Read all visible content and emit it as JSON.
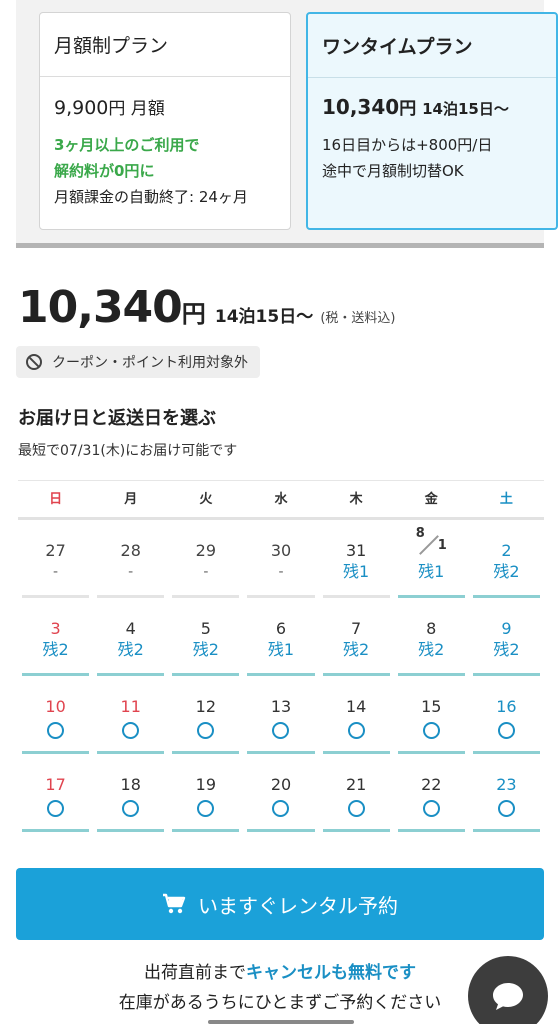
{
  "plans": {
    "monthly": {
      "title": "月額制プラン",
      "price_num": "9,900",
      "price_unit": "円 月額",
      "promo_line1": "3ヶ月以上のご利用で",
      "promo_line2": "解約料が0円に",
      "note": "月額課金の自動終了: 24ヶ月"
    },
    "onetime": {
      "title": "ワンタイムプラン",
      "price_num": "10,340",
      "price_unit": "円",
      "price_period": "14泊15日〜",
      "line1": "16日目からは+800円/日",
      "line2": "途中で月額制切替OK"
    }
  },
  "main_price": {
    "amount": "10,340",
    "yen": "円",
    "period": "14泊15日〜",
    "tax": "(税・送料込)"
  },
  "coupon_notice": "クーポン・ポイント利用対象外",
  "section": {
    "title": "お届け日と返送日を選ぶ",
    "subtitle": "最短で07/31(木)にお届け可能です"
  },
  "calendar": {
    "weekdays": [
      "日",
      "月",
      "火",
      "水",
      "木",
      "金",
      "土"
    ],
    "rows": [
      [
        {
          "date": "27",
          "status": "-"
        },
        {
          "date": "28",
          "status": "-"
        },
        {
          "date": "29",
          "status": "-"
        },
        {
          "date": "30",
          "status": "-"
        },
        {
          "date": "31",
          "status": "残1"
        },
        {
          "date_a": "8",
          "date_b": "1",
          "status": "残1"
        },
        {
          "date": "2",
          "status": "残2"
        }
      ],
      [
        {
          "date": "3",
          "status": "残2"
        },
        {
          "date": "4",
          "status": "残2"
        },
        {
          "date": "5",
          "status": "残2"
        },
        {
          "date": "6",
          "status": "残1"
        },
        {
          "date": "7",
          "status": "残2"
        },
        {
          "date": "8",
          "status": "残2"
        },
        {
          "date": "9",
          "status": "残2"
        }
      ],
      [
        {
          "date": "10",
          "status": "circle"
        },
        {
          "date": "11",
          "status": "circle"
        },
        {
          "date": "12",
          "status": "circle"
        },
        {
          "date": "13",
          "status": "circle"
        },
        {
          "date": "14",
          "status": "circle"
        },
        {
          "date": "15",
          "status": "circle"
        },
        {
          "date": "16",
          "status": "circle"
        }
      ],
      [
        {
          "date": "17",
          "status": "circle"
        },
        {
          "date": "18",
          "status": "circle"
        },
        {
          "date": "19",
          "status": "circle"
        },
        {
          "date": "20",
          "status": "circle"
        },
        {
          "date": "21",
          "status": "circle"
        },
        {
          "date": "22",
          "status": "circle"
        },
        {
          "date": "23",
          "status": "circle"
        }
      ]
    ]
  },
  "cta": {
    "label": "いますぐレンタル予約"
  },
  "notes": {
    "line1_pre": "出荷直前まで",
    "line1_highlight": "キャンセルも無料です",
    "line2": "在庫があるうちにひとまずご予約ください"
  },
  "colors": {
    "accent": "#1ba1d9",
    "sunday": "#e0444f",
    "saturday": "#1a8fc4",
    "promo_green": "#3aa84a"
  }
}
